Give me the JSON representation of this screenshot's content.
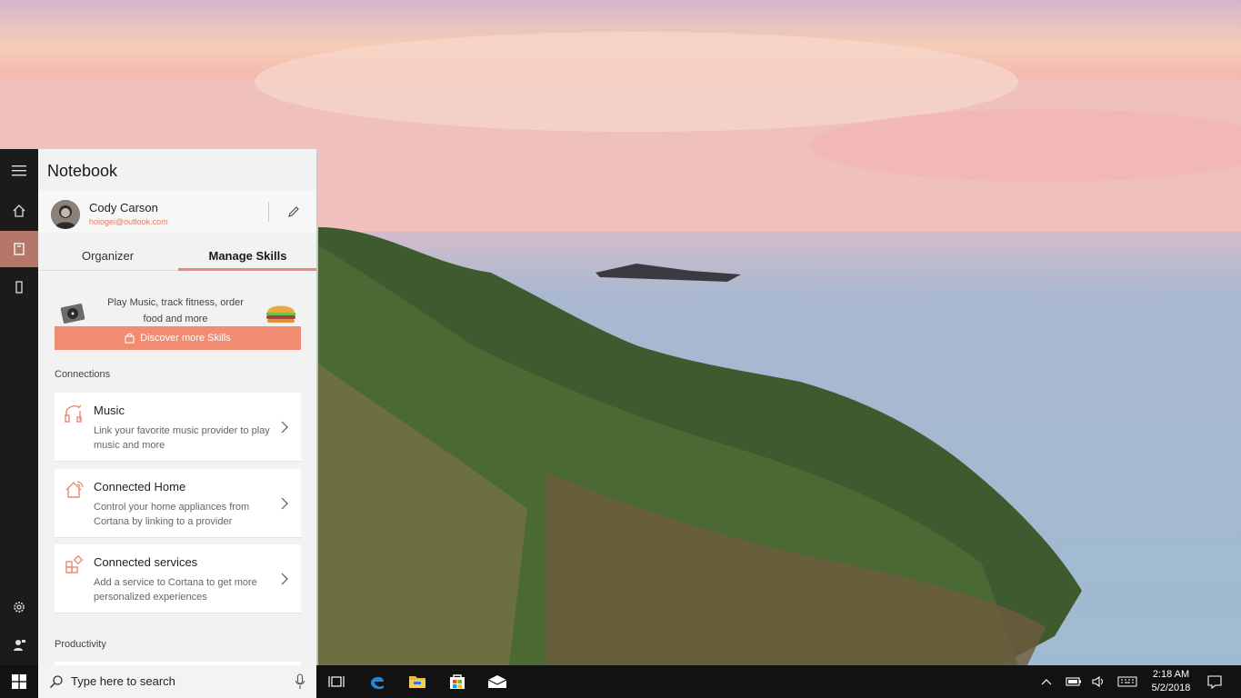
{
  "cortana": {
    "title": "Notebook",
    "profile": {
      "name": "Cody Carson",
      "email": "hoiogei@outlook.com"
    },
    "tabs": [
      "Organizer",
      "Manage Skills"
    ],
    "promo": {
      "text": "Play Music, track fitness, order food and more",
      "button": "Discover more Skills"
    },
    "connections_label": "Connections",
    "cards": [
      {
        "title": "Music",
        "desc": "Link your favorite music provider to play music and more",
        "icon": "headphones-icon"
      },
      {
        "title": "Connected Home",
        "desc": "Control your home appliances from Cortana by linking to a provider",
        "icon": "home-icon"
      },
      {
        "title": "Connected services",
        "desc": "Add a service to Cortana to get more personalized experiences",
        "icon": "apps-icon"
      }
    ],
    "productivity_label": "Productivity",
    "accent": "#f28c73"
  },
  "taskbar": {
    "search_placeholder": "Type here to search",
    "time": "2:18 AM",
    "date": "5/2/2018"
  }
}
